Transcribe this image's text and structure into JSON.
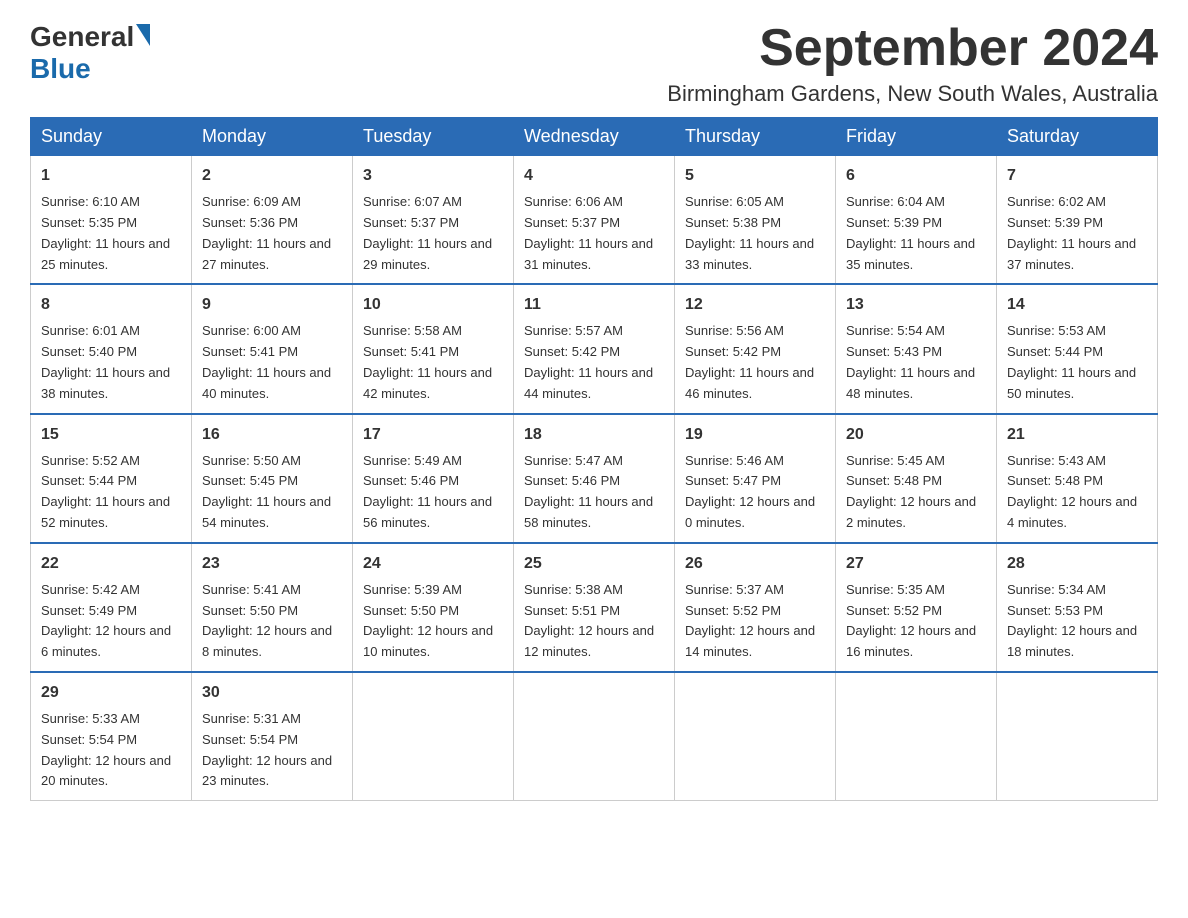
{
  "logo": {
    "general": "General",
    "blue": "Blue"
  },
  "header": {
    "month": "September 2024",
    "location": "Birmingham Gardens, New South Wales, Australia"
  },
  "days_of_week": [
    "Sunday",
    "Monday",
    "Tuesday",
    "Wednesday",
    "Thursday",
    "Friday",
    "Saturday"
  ],
  "weeks": [
    [
      {
        "day": "1",
        "sunrise": "6:10 AM",
        "sunset": "5:35 PM",
        "daylight": "11 hours and 25 minutes."
      },
      {
        "day": "2",
        "sunrise": "6:09 AM",
        "sunset": "5:36 PM",
        "daylight": "11 hours and 27 minutes."
      },
      {
        "day": "3",
        "sunrise": "6:07 AM",
        "sunset": "5:37 PM",
        "daylight": "11 hours and 29 minutes."
      },
      {
        "day": "4",
        "sunrise": "6:06 AM",
        "sunset": "5:37 PM",
        "daylight": "11 hours and 31 minutes."
      },
      {
        "day": "5",
        "sunrise": "6:05 AM",
        "sunset": "5:38 PM",
        "daylight": "11 hours and 33 minutes."
      },
      {
        "day": "6",
        "sunrise": "6:04 AM",
        "sunset": "5:39 PM",
        "daylight": "11 hours and 35 minutes."
      },
      {
        "day": "7",
        "sunrise": "6:02 AM",
        "sunset": "5:39 PM",
        "daylight": "11 hours and 37 minutes."
      }
    ],
    [
      {
        "day": "8",
        "sunrise": "6:01 AM",
        "sunset": "5:40 PM",
        "daylight": "11 hours and 38 minutes."
      },
      {
        "day": "9",
        "sunrise": "6:00 AM",
        "sunset": "5:41 PM",
        "daylight": "11 hours and 40 minutes."
      },
      {
        "day": "10",
        "sunrise": "5:58 AM",
        "sunset": "5:41 PM",
        "daylight": "11 hours and 42 minutes."
      },
      {
        "day": "11",
        "sunrise": "5:57 AM",
        "sunset": "5:42 PM",
        "daylight": "11 hours and 44 minutes."
      },
      {
        "day": "12",
        "sunrise": "5:56 AM",
        "sunset": "5:42 PM",
        "daylight": "11 hours and 46 minutes."
      },
      {
        "day": "13",
        "sunrise": "5:54 AM",
        "sunset": "5:43 PM",
        "daylight": "11 hours and 48 minutes."
      },
      {
        "day": "14",
        "sunrise": "5:53 AM",
        "sunset": "5:44 PM",
        "daylight": "11 hours and 50 minutes."
      }
    ],
    [
      {
        "day": "15",
        "sunrise": "5:52 AM",
        "sunset": "5:44 PM",
        "daylight": "11 hours and 52 minutes."
      },
      {
        "day": "16",
        "sunrise": "5:50 AM",
        "sunset": "5:45 PM",
        "daylight": "11 hours and 54 minutes."
      },
      {
        "day": "17",
        "sunrise": "5:49 AM",
        "sunset": "5:46 PM",
        "daylight": "11 hours and 56 minutes."
      },
      {
        "day": "18",
        "sunrise": "5:47 AM",
        "sunset": "5:46 PM",
        "daylight": "11 hours and 58 minutes."
      },
      {
        "day": "19",
        "sunrise": "5:46 AM",
        "sunset": "5:47 PM",
        "daylight": "12 hours and 0 minutes."
      },
      {
        "day": "20",
        "sunrise": "5:45 AM",
        "sunset": "5:48 PM",
        "daylight": "12 hours and 2 minutes."
      },
      {
        "day": "21",
        "sunrise": "5:43 AM",
        "sunset": "5:48 PM",
        "daylight": "12 hours and 4 minutes."
      }
    ],
    [
      {
        "day": "22",
        "sunrise": "5:42 AM",
        "sunset": "5:49 PM",
        "daylight": "12 hours and 6 minutes."
      },
      {
        "day": "23",
        "sunrise": "5:41 AM",
        "sunset": "5:50 PM",
        "daylight": "12 hours and 8 minutes."
      },
      {
        "day": "24",
        "sunrise": "5:39 AM",
        "sunset": "5:50 PM",
        "daylight": "12 hours and 10 minutes."
      },
      {
        "day": "25",
        "sunrise": "5:38 AM",
        "sunset": "5:51 PM",
        "daylight": "12 hours and 12 minutes."
      },
      {
        "day": "26",
        "sunrise": "5:37 AM",
        "sunset": "5:52 PM",
        "daylight": "12 hours and 14 minutes."
      },
      {
        "day": "27",
        "sunrise": "5:35 AM",
        "sunset": "5:52 PM",
        "daylight": "12 hours and 16 minutes."
      },
      {
        "day": "28",
        "sunrise": "5:34 AM",
        "sunset": "5:53 PM",
        "daylight": "12 hours and 18 minutes."
      }
    ],
    [
      {
        "day": "29",
        "sunrise": "5:33 AM",
        "sunset": "5:54 PM",
        "daylight": "12 hours and 20 minutes."
      },
      {
        "day": "30",
        "sunrise": "5:31 AM",
        "sunset": "5:54 PM",
        "daylight": "12 hours and 23 minutes."
      },
      null,
      null,
      null,
      null,
      null
    ]
  ],
  "labels": {
    "sunrise": "Sunrise: ",
    "sunset": "Sunset: ",
    "daylight": "Daylight: "
  }
}
